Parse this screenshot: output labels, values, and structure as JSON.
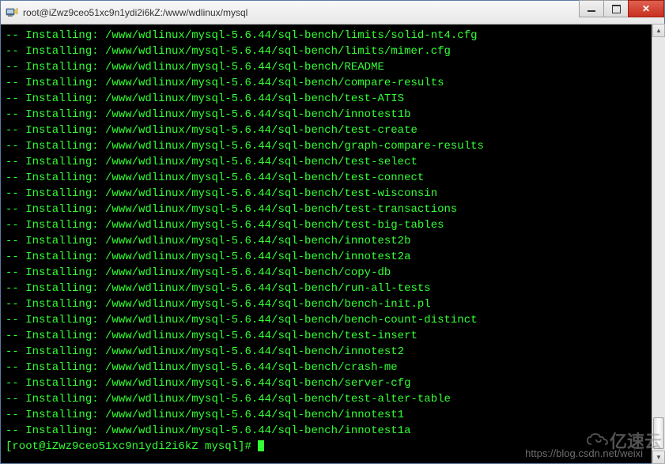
{
  "window": {
    "title": "root@iZwz9ceo51xc9n1ydi2i6kZ:/www/wdlinux/mysql"
  },
  "terminal": {
    "lines": [
      "-- Installing: /www/wdlinux/mysql-5.6.44/sql-bench/limits/solid-nt4.cfg",
      "-- Installing: /www/wdlinux/mysql-5.6.44/sql-bench/limits/mimer.cfg",
      "-- Installing: /www/wdlinux/mysql-5.6.44/sql-bench/README",
      "-- Installing: /www/wdlinux/mysql-5.6.44/sql-bench/compare-results",
      "-- Installing: /www/wdlinux/mysql-5.6.44/sql-bench/test-ATIS",
      "-- Installing: /www/wdlinux/mysql-5.6.44/sql-bench/innotest1b",
      "-- Installing: /www/wdlinux/mysql-5.6.44/sql-bench/test-create",
      "-- Installing: /www/wdlinux/mysql-5.6.44/sql-bench/graph-compare-results",
      "-- Installing: /www/wdlinux/mysql-5.6.44/sql-bench/test-select",
      "-- Installing: /www/wdlinux/mysql-5.6.44/sql-bench/test-connect",
      "-- Installing: /www/wdlinux/mysql-5.6.44/sql-bench/test-wisconsin",
      "-- Installing: /www/wdlinux/mysql-5.6.44/sql-bench/test-transactions",
      "-- Installing: /www/wdlinux/mysql-5.6.44/sql-bench/test-big-tables",
      "-- Installing: /www/wdlinux/mysql-5.6.44/sql-bench/innotest2b",
      "-- Installing: /www/wdlinux/mysql-5.6.44/sql-bench/innotest2a",
      "-- Installing: /www/wdlinux/mysql-5.6.44/sql-bench/copy-db",
      "-- Installing: /www/wdlinux/mysql-5.6.44/sql-bench/run-all-tests",
      "-- Installing: /www/wdlinux/mysql-5.6.44/sql-bench/bench-init.pl",
      "-- Installing: /www/wdlinux/mysql-5.6.44/sql-bench/bench-count-distinct",
      "-- Installing: /www/wdlinux/mysql-5.6.44/sql-bench/test-insert",
      "-- Installing: /www/wdlinux/mysql-5.6.44/sql-bench/innotest2",
      "-- Installing: /www/wdlinux/mysql-5.6.44/sql-bench/crash-me",
      "-- Installing: /www/wdlinux/mysql-5.6.44/sql-bench/server-cfg",
      "-- Installing: /www/wdlinux/mysql-5.6.44/sql-bench/test-alter-table",
      "-- Installing: /www/wdlinux/mysql-5.6.44/sql-bench/innotest1",
      "-- Installing: /www/wdlinux/mysql-5.6.44/sql-bench/innotest1a"
    ],
    "prompt": "[root@iZwz9ceo51xc9n1ydi2i6kZ mysql]# "
  },
  "watermark": {
    "text": "https://blog.csdn.net/weixi",
    "logo_text": "亿速云"
  }
}
